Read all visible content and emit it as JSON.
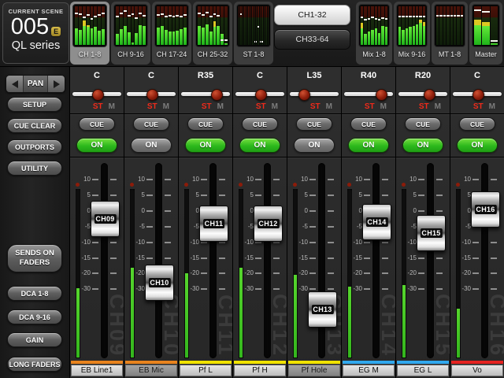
{
  "scene": {
    "label": "CURRENT SCENE",
    "number": "005",
    "edit_badge": "E",
    "series": "QL series"
  },
  "top": {
    "bank_buttons": [
      {
        "label": "CH1-32",
        "selected": true
      },
      {
        "label": "CH33-64",
        "selected": false
      }
    ],
    "left_meters": [
      {
        "label": "CH 1-8",
        "selected": true,
        "bars": [
          0.42,
          0.38,
          0.5,
          0.46,
          0.42,
          0.46,
          0.36,
          0.4
        ],
        "yellows": [
          0,
          0,
          0.64,
          0.52,
          0,
          0,
          0,
          0
        ],
        "peaks": [
          0.8,
          0.78,
          0.7,
          0.75,
          0.66,
          0.72,
          0.76,
          0.8
        ]
      },
      {
        "label": "CH 9-16",
        "selected": false,
        "bars": [
          0.28,
          0.4,
          0.48,
          0.33,
          0.06,
          0.3,
          0.52,
          0.5
        ],
        "yellows": [
          0,
          0,
          0,
          0,
          0,
          0,
          0,
          0
        ],
        "peaks": [
          0.72,
          0.8,
          0.86,
          0.74,
          0.78,
          0.68,
          0.8,
          0.74
        ]
      },
      {
        "label": "CH 17-24",
        "selected": false,
        "bars": [
          0.44,
          0.5,
          0.38,
          0.34,
          0.34,
          0.36,
          0.4,
          0.44
        ],
        "yellows": [
          0,
          0,
          0,
          0,
          0,
          0,
          0,
          0
        ],
        "peaks": [
          0.76,
          0.78,
          0.72,
          0.74,
          0.72,
          0.74,
          0.72,
          0.76
        ]
      },
      {
        "label": "CH 25-32",
        "selected": false,
        "bars": [
          0.48,
          0.44,
          0.54,
          0.34,
          0.46,
          0.5,
          0.28,
          0.05
        ],
        "yellows": [
          0,
          0,
          0,
          0,
          0.62,
          0,
          0,
          0
        ],
        "peaks": [
          0.8,
          0.76,
          0.82,
          0.72,
          0.78,
          0.74,
          0.1,
          0.1
        ]
      },
      {
        "label": "ST 1-8",
        "selected": false,
        "bars": [
          0,
          0,
          0,
          0,
          0,
          0,
          0,
          0,
          0,
          0,
          0,
          0,
          0,
          0,
          0,
          0
        ],
        "yellows": [
          0,
          0,
          0,
          0,
          0,
          0,
          0,
          0,
          0,
          0,
          0,
          0,
          0,
          0,
          0,
          0
        ],
        "peaks": [
          null,
          0.78,
          null,
          null,
          null,
          null,
          null,
          null,
          0.06,
          0.06,
          0.45,
          0.06,
          0.06,
          null,
          null,
          null
        ]
      }
    ],
    "right_meters": [
      {
        "label": "Mix 1-8",
        "selected": false,
        "bars": [
          0.42,
          0.28,
          0.34,
          0.38,
          0.42,
          0.3,
          0.5,
          0.46
        ],
        "yellows": [
          0.58,
          0,
          0,
          0,
          0,
          0,
          0,
          0
        ],
        "peaks": [
          0.7,
          0.64,
          0.66,
          0.7,
          0.66,
          0.64,
          0.68,
          0.66
        ]
      },
      {
        "label": "Mix 9-16",
        "selected": false,
        "bars": [
          0.46,
          0.38,
          0.42,
          0.46,
          0.5,
          0.54,
          0.58,
          0.5
        ],
        "yellows": [
          0,
          0,
          0,
          0,
          0,
          0,
          0.66,
          0.6
        ],
        "peaks": [
          0.72,
          0.72,
          0.72,
          0.72,
          0.72,
          0.72,
          0.72,
          0.72
        ]
      },
      {
        "label": "MT 1-8",
        "selected": false,
        "bars": [
          0,
          0,
          0,
          0,
          0,
          0,
          0,
          0
        ],
        "yellows": [
          0,
          0,
          0,
          0,
          0,
          0,
          0,
          0
        ],
        "peaks": [
          0.74,
          0.74,
          0.74,
          0.74,
          0.74,
          0.74,
          0.74,
          0.74
        ]
      },
      {
        "label": "Master",
        "selected": false,
        "bars": [
          0.52,
          0.48,
          0.04
        ],
        "yellows": [
          0.66,
          0.6,
          0
        ],
        "peaks": [
          0.88,
          0.84,
          0.08
        ]
      }
    ]
  },
  "sidebar": {
    "pan_label": "PAN",
    "buttons": [
      "SETUP",
      "CUE CLEAR",
      "OUTPORTS",
      "UTILITY"
    ],
    "sends_label": "SENDS ON FADERS",
    "lower_buttons": [
      "DCA 1-8",
      "DCA 9-16",
      "GAIN",
      "LONG FADERS"
    ]
  },
  "strip_labels": {
    "st": "ST",
    "mono": "M",
    "cue": "CUE",
    "on": "ON"
  },
  "fader_scale": [
    "10",
    "5",
    "0",
    "-5",
    "-10",
    "-15",
    "-20",
    "-30"
  ],
  "strips": [
    {
      "pan_value": "C",
      "pan_pos": 0.5,
      "on": true,
      "cap_label": "CH09",
      "fader_pos": 0.282,
      "meter_level": 0.41,
      "name": "EB Line1",
      "color": "#e8831e",
      "active": true
    },
    {
      "pan_value": "C",
      "pan_pos": 0.5,
      "on": false,
      "cap_label": "CH10",
      "fader_pos": 0.609,
      "meter_level": 0.53,
      "name": "EB Mic",
      "color": "#e8831e",
      "active": false
    },
    {
      "pan_value": "R35",
      "pan_pos": 0.78,
      "on": true,
      "cap_label": "CH11",
      "fader_pos": 0.306,
      "meter_level": 0.5,
      "name": "Pf L",
      "color": "#f0e202",
      "active": true
    },
    {
      "pan_value": "C",
      "pan_pos": 0.5,
      "on": true,
      "cap_label": "CH12",
      "fader_pos": 0.306,
      "meter_level": 0.53,
      "name": "Pf H",
      "color": "#f0e202",
      "active": true
    },
    {
      "pan_value": "L35",
      "pan_pos": 0.22,
      "on": false,
      "cap_label": "CH13",
      "fader_pos": 0.746,
      "meter_level": 0.49,
      "name": "Pf Hole",
      "color": "#f0e202",
      "active": false
    },
    {
      "pan_value": "R40",
      "pan_pos": 0.82,
      "on": true,
      "cap_label": "CH14",
      "fader_pos": 0.298,
      "meter_level": 0.42,
      "name": "EG M",
      "color": "#31a8ee",
      "active": true
    },
    {
      "pan_value": "R20",
      "pan_pos": 0.66,
      "on": true,
      "cap_label": "CH15",
      "fader_pos": 0.355,
      "meter_level": 0.43,
      "name": "EG L",
      "color": "#31a8ee",
      "active": true
    },
    {
      "pan_value": "C",
      "pan_pos": 0.5,
      "on": true,
      "cap_label": "CH16",
      "fader_pos": 0.234,
      "meter_level": 0.29,
      "name": "Vo",
      "color": "#e42320",
      "active": true
    }
  ],
  "colors": {
    "on_green": "#2cb81c",
    "st_red": "#ef2a1a",
    "pan_knob_red": "#8e1e0c"
  }
}
